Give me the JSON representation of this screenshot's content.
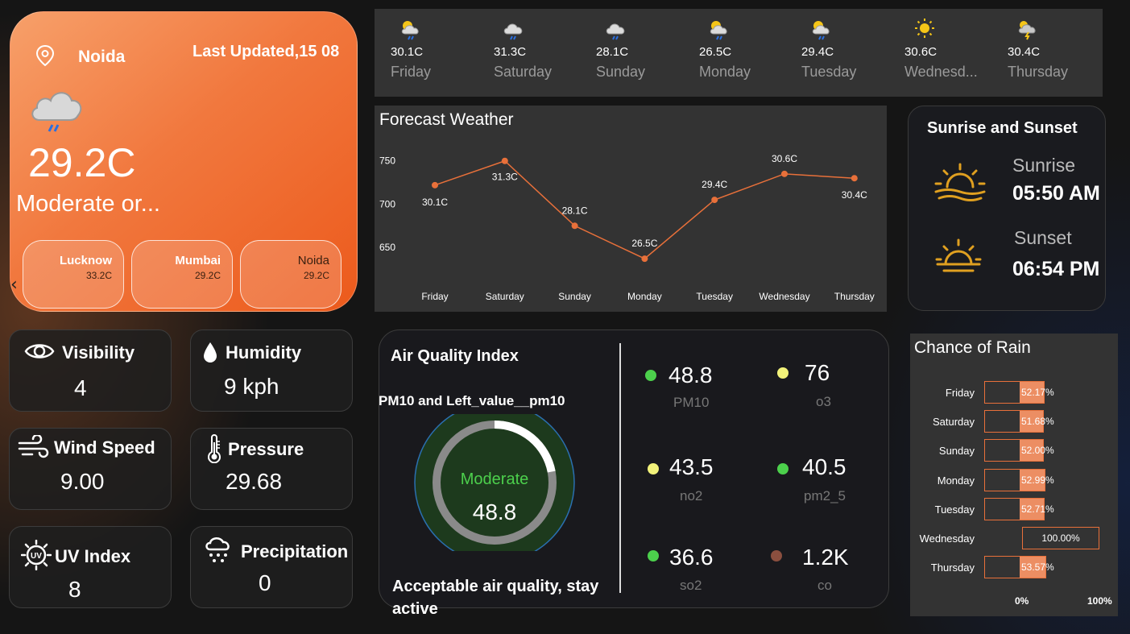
{
  "location": {
    "city": "Noida",
    "last_updated": "Last Updated,15 08",
    "temperature": "29.2C",
    "condition": "Moderate or...",
    "icon": "rain-cloud-icon"
  },
  "cities": [
    {
      "name": "Lucknow",
      "temp": "33.2C"
    },
    {
      "name": "Mumbai",
      "temp": "29.2C"
    },
    {
      "name": "Noida",
      "temp": "29.2C"
    }
  ],
  "daily": [
    {
      "temp": "30.1C",
      "day": "Friday",
      "icon": "sun-cloud-rain-icon"
    },
    {
      "temp": "31.3C",
      "day": "Saturday",
      "icon": "cloud-rain-icon"
    },
    {
      "temp": "28.1C",
      "day": "Sunday",
      "icon": "cloud-rain-icon"
    },
    {
      "temp": "26.5C",
      "day": "Monday",
      "icon": "sun-cloud-rain-icon"
    },
    {
      "temp": "29.4C",
      "day": "Tuesday",
      "icon": "sun-cloud-rain-icon"
    },
    {
      "temp": "30.6C",
      "day": "Wednesd...",
      "icon": "sun-icon"
    },
    {
      "temp": "30.4C",
      "day": "Thursday",
      "icon": "thunder-cloud-icon"
    }
  ],
  "forecast": {
    "title": "Forecast Weather"
  },
  "chart_data": {
    "type": "line",
    "title": "Forecast Weather",
    "categories": [
      "Friday",
      "Saturday",
      "Sunday",
      "Monday",
      "Tuesday",
      "Wednesday",
      "Thursday"
    ],
    "values": [
      722,
      750,
      675,
      637,
      705,
      735,
      730
    ],
    "labels": [
      "30.1C",
      "31.3C",
      "28.1C",
      "26.5C",
      "29.4C",
      "30.6C",
      "30.4C"
    ],
    "yticks": [
      "750",
      "700",
      "650"
    ],
    "ylim": [
      625,
      760
    ],
    "color": "#e8703a"
  },
  "sun": {
    "title": "Sunrise and Sunset",
    "sunrise_label": "Sunrise",
    "sunrise_time": "05:50 AM",
    "sunset_label": "Sunset",
    "sunset_time": "06:54 PM",
    "color": "#e0a020"
  },
  "metrics": {
    "visibility": {
      "label": "Visibility",
      "value": "4"
    },
    "humidity": {
      "label": "Humidity",
      "value": "9 kph"
    },
    "wind": {
      "label": "Wind Speed",
      "value": "9.00"
    },
    "pressure": {
      "label": "Pressure",
      "value": "29.68"
    },
    "uv": {
      "label": "UV Index",
      "value": "8"
    },
    "precip": {
      "label": "Precipitation",
      "value": "0"
    }
  },
  "aqi": {
    "title": "Air Quality Index",
    "subtitle": "PM10 and Left_value__pm10",
    "status": "Moderate",
    "value": "48.8",
    "gauge_fraction": 0.22,
    "note": "Acceptable air quality, stay active",
    "pollutants": [
      {
        "value": "48.8",
        "name": "PM10",
        "color": "#4cd04c"
      },
      {
        "value": "76",
        "name": "o3",
        "color": "#f2f27a"
      },
      {
        "value": "43.5",
        "name": "no2",
        "color": "#f2f27a"
      },
      {
        "value": "40.5",
        "name": "pm2_5",
        "color": "#4cd04c"
      },
      {
        "value": "36.6",
        "name": "so2",
        "color": "#4cd04c"
      },
      {
        "value": "1.2K",
        "name": "co",
        "color": "#8b4f3f"
      }
    ]
  },
  "rain": {
    "title": "Chance of Rain",
    "rows": [
      {
        "day": "Friday",
        "label": "52.17%",
        "pct": 52.17
      },
      {
        "day": "Saturday",
        "label": "51.68%",
        "pct": 51.68
      },
      {
        "day": "Sunday",
        "label": "52.00%",
        "pct": 52.0
      },
      {
        "day": "Monday",
        "label": "52.99%",
        "pct": 52.99
      },
      {
        "day": "Tuesday",
        "label": "52.71%",
        "pct": 52.71
      },
      {
        "day": "Wednesday",
        "label": "100.00%",
        "pct": 100
      },
      {
        "day": "Thursday",
        "label": "53.57%",
        "pct": 53.57
      }
    ],
    "axis_min": "0%",
    "axis_max": "100%"
  }
}
